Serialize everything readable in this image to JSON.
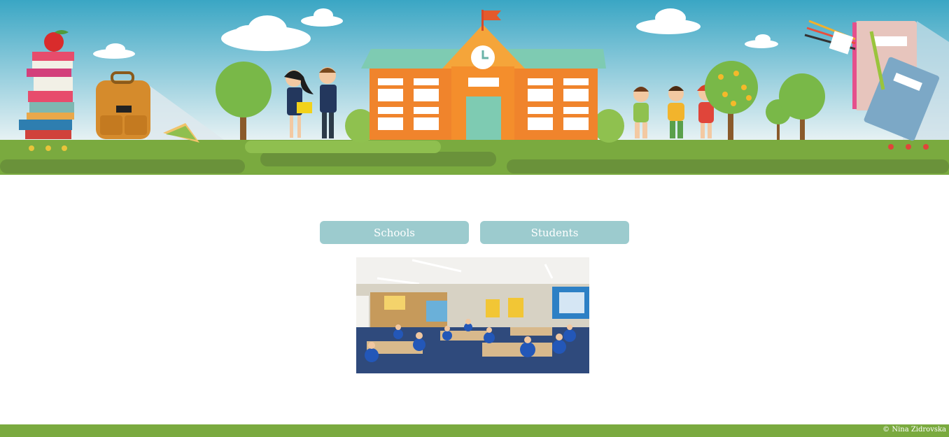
{
  "nav": {
    "schools_label": "Schools",
    "students_label": "Students"
  },
  "footer": {
    "credit": "© Nina Zidrovska"
  },
  "colors": {
    "sky_top": "#3aa6c4",
    "grass": "#7aaa3f",
    "button": "#9ccbce",
    "school": "#f0842c",
    "footer": "#7aaa3f"
  },
  "banner": {
    "icons": [
      "books-stack-icon",
      "apple-icon",
      "backpack-icon",
      "sandwich-icon",
      "tree-icon",
      "students-pair-icon",
      "school-building-icon",
      "flag-icon",
      "clock-icon",
      "children-group-icon",
      "orange-tree-icon",
      "notebook-icon",
      "pencils-icon",
      "cloud-icon"
    ]
  }
}
